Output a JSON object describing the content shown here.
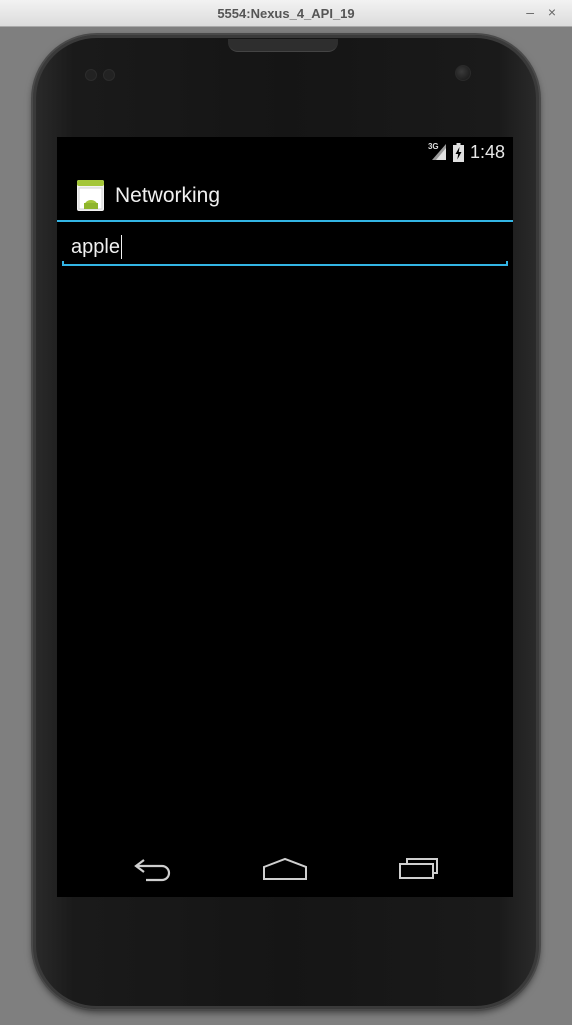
{
  "window": {
    "title": "5554:Nexus_4_API_19",
    "minimize_glyph": "–",
    "close_glyph": "×"
  },
  "status_bar": {
    "network_type": "3G",
    "time": "1:48",
    "icons": [
      "signal-icon",
      "battery-icon"
    ]
  },
  "action_bar": {
    "app_icon": "android-app-icon",
    "title": "Networking"
  },
  "edit_text": {
    "value": "apple",
    "accent_color": "#33b5e5"
  },
  "nav_bar": {
    "buttons": [
      "back-icon",
      "home-icon",
      "recent-apps-icon"
    ]
  }
}
